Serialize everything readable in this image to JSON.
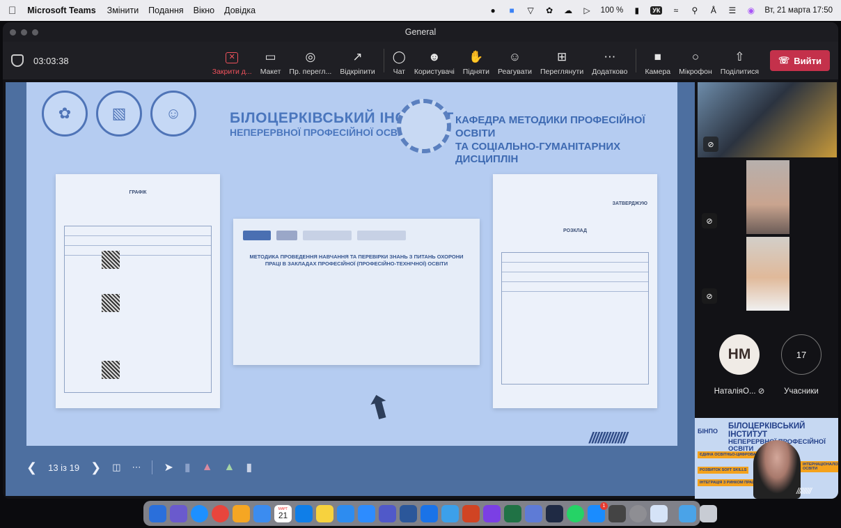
{
  "menubar": {
    "app_name": "Microsoft Teams",
    "menus": [
      "Змінити",
      "Подання",
      "Вікно",
      "Довідка"
    ],
    "battery": "100 %",
    "input_lang": "УК",
    "datetime": "Вт, 21 марта  17:50"
  },
  "window": {
    "title": "General"
  },
  "toolbar": {
    "timer": "03:03:38",
    "buttons": [
      {
        "label": "Закрити д...",
        "icon": "close-share-icon"
      },
      {
        "label": "Макет",
        "icon": "layout-icon"
      },
      {
        "label": "Пр. перегл...",
        "icon": "view-icon"
      },
      {
        "label": "Відкріпити",
        "icon": "popout-icon"
      },
      {
        "label": "Чат",
        "icon": "chat-icon"
      },
      {
        "label": "Користувачі",
        "icon": "people-icon"
      },
      {
        "label": "Підняти",
        "icon": "hand-icon"
      },
      {
        "label": "Реагувати",
        "icon": "emoji-icon"
      },
      {
        "label": "Переглянути",
        "icon": "grid-icon"
      },
      {
        "label": "Додатково",
        "icon": "more-icon"
      },
      {
        "label": "Камера",
        "icon": "camera-icon"
      },
      {
        "label": "Мікрофон",
        "icon": "mic-icon"
      },
      {
        "label": "Поділитися",
        "icon": "share-icon"
      }
    ],
    "leave_label": "Вийти"
  },
  "slide": {
    "inst_title_1": "БІЛОЦЕРКІВСЬКИЙ ІНСТИТУТ",
    "inst_title_2": "НЕПЕРЕРВНОЇ ПРОФЕСІЙНОЇ ОСВІТИ",
    "dept_title_1": "КАФЕДРА МЕТОДИКИ ПРОФЕСІЙНОЇ ОСВІТИ",
    "dept_title_2": "ТА СОЦІАЛЬНО-ГУМАНІТАРНИХ ДИСЦИПЛІН",
    "left_doc_title": "ГРАФІК",
    "center_doc_title": "МЕТОДИКА ПРОВЕДЕННЯ НАВЧАННЯ ТА ПЕРЕВІРКИ ЗНАНЬ З ПИТАНЬ ОХОРОНИ ПРАЦІ В ЗАКЛАДАХ ПРОФЕСІЙНОЇ (ПРОФЕСІЙНО-ТЕХНІЧНОЇ) ОСВІТИ",
    "right_doc_title": "РОЗКЛАД",
    "right_doc_subtitle": "ЗАТВЕРДЖУЮ"
  },
  "slide_nav": {
    "counter": "13 із 19"
  },
  "participants": {
    "avatar_initials": "НМ",
    "avatar_name": "НаталіяО...",
    "count": "17",
    "count_label": "Учасники"
  },
  "presenter": {
    "title_1": "БІЛОЦЕРКІВСЬКИЙ ІНСТИТУТ",
    "title_2": "НЕПЕРЕРВНОЇ ПРОФЕСІЙНОЇ ОСВІТИ",
    "bino": "БІНПО",
    "badges": [
      "ЄДИНА ОСВІТНЬО-ЦИФРОВА ЕКОСИСТЕМА",
      "РОЗВИТОК SOFT SKILLS",
      "ІНТЕГРАЦІЯ З РИНКОМ ПРАЦІ",
      "ІНТЕРНАЦІОНАЛІЗАЦІЯ ОСВІТИ"
    ]
  },
  "dock": {
    "calendar_month": "МАРТ",
    "calendar_day": "21",
    "badge_count": "1"
  },
  "colors": {
    "leave": "#c4314b",
    "active_tool": "#f0525c",
    "slide_bg": "#b5ccf1",
    "slide_frame": "#4d6fa0"
  }
}
